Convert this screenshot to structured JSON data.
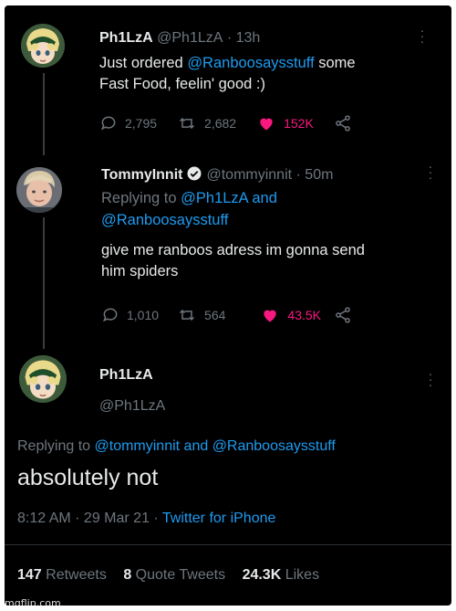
{
  "tweet1": {
    "display_name": "Ph1LzA",
    "handle": "@Ph1LzA",
    "time": "· 13h",
    "text_line1_a": "Just ordered ",
    "text_line1_mention": "@Ranboosaysstuff",
    "text_line1_b": " some",
    "text_line2": "Fast Food, feelin' good :)",
    "replies": "2,795",
    "retweets": "2,682",
    "likes": "152K"
  },
  "tweet2": {
    "display_name": "TommyInnit",
    "handle": "@tommyinnit",
    "time": "· 50m",
    "replying_prefix": "Replying to ",
    "replying_mention1": "@Ph1LzA",
    "replying_and": " and",
    "replying_mention2": "@Ranboosaysstuff",
    "text_line1": "give me ranboos adress im gonna send",
    "text_line2": "him spiders",
    "replies": "1,010",
    "retweets": "564",
    "likes": "43.5K"
  },
  "tweet3": {
    "display_name": "Ph1LzA",
    "handle": "@Ph1LzA",
    "replying_prefix": "Replying to ",
    "replying_mention1": "@tommyinnit",
    "replying_and": " and ",
    "replying_mention2": "@Ranboosaysstuff",
    "text": "absolutely not",
    "timestamp": "8:12 AM · 29 Mar 21 · ",
    "client": "Twitter for iPhone",
    "retweets_count": "147",
    "retweets_label": "Retweets",
    "quotes_count": "8",
    "quotes_label": "Quote Tweets",
    "likes_count": "24.3K",
    "likes_label": "Likes"
  },
  "watermark": "imgflip.com",
  "colors": {
    "background": "#000000",
    "link": "#1d9bf0",
    "like": "#f91880",
    "muted": "#6e767d",
    "text": "#e7e9ea"
  },
  "icons": [
    "reply-icon",
    "retweet-icon",
    "heart-icon",
    "share-icon",
    "verified-icon",
    "more-icon"
  ]
}
